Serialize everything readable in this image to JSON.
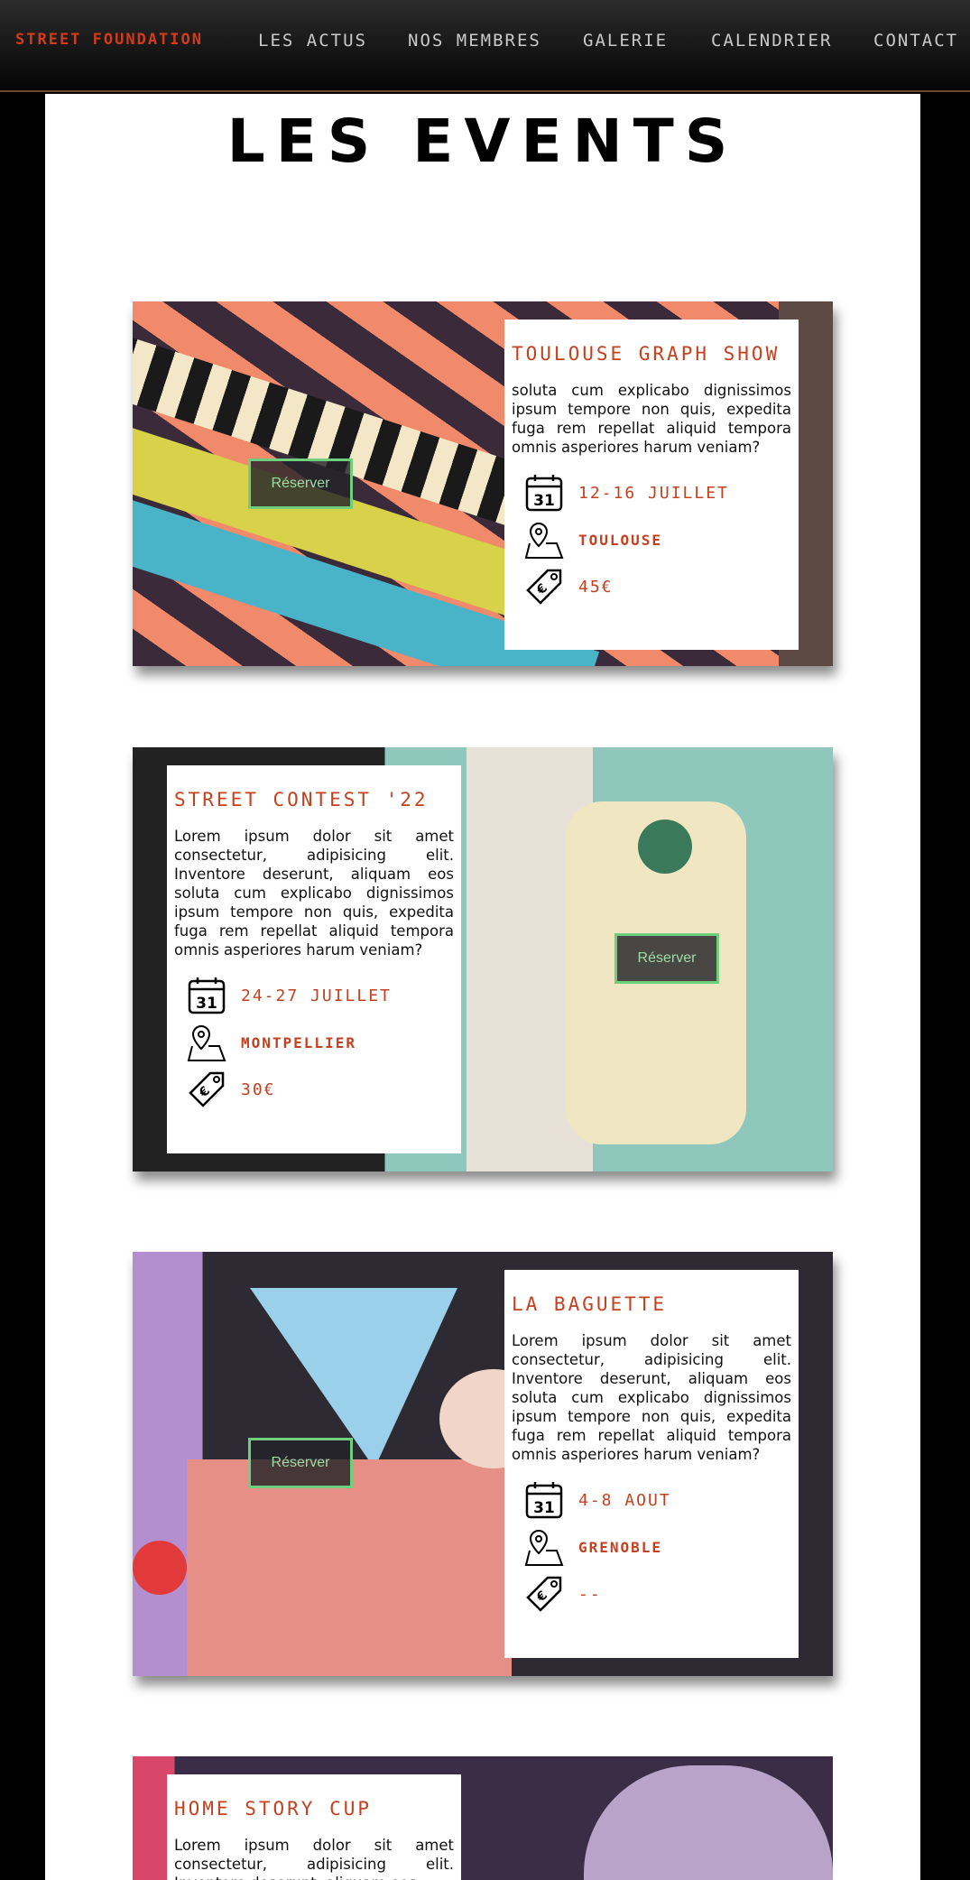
{
  "nav": {
    "brand": "STREET FOUNDATION",
    "links": [
      "LES ACTUS",
      "NOS MEMBRES",
      "GALERIE",
      "CALENDRIER",
      "CONTACT"
    ]
  },
  "page_title": "LES EVENTS",
  "events": [
    {
      "title": "TOULOUSE GRAPH SHOW",
      "description": "soluta cum explicabo dignissimos ipsum tempore non quis, expedita fuga rem repellat aliquid tempora omnis asperiores harum veniam?",
      "date": "12-16 JUILLET",
      "location": "TOULOUSE",
      "price": "45€",
      "button": "Réserver"
    },
    {
      "title": "STREET CONTEST '22",
      "description": "Lorem ipsum dolor sit amet consectetur, adipisicing elit. Inventore deserunt, aliquam eos soluta cum explicabo dignissimos ipsum tempore non quis, expedita fuga rem repellat aliquid tempora omnis asperiores harum veniam?",
      "date": "24-27 JUILLET",
      "location": "MONTPELLIER",
      "price": "30€",
      "button": "Réserver"
    },
    {
      "title": "LA BAGUETTE",
      "description": "Lorem ipsum dolor sit amet consectetur, adipisicing elit. Inventore deserunt, aliquam eos soluta cum explicabo dignissimos ipsum tempore non quis, expedita fuga rem repellat aliquid tempora omnis asperiores harum veniam?",
      "date": "4-8 AOUT",
      "location": "GRENOBLE",
      "price": "--",
      "button": "Réserver"
    },
    {
      "title": "HOME STORY CUP",
      "description": "Lorem ipsum dolor sit amet consectetur, adipisicing elit. Inventore deserunt, aliquam eos"
    }
  ],
  "colors": {
    "accent": "#c4411f",
    "button_border": "#6fcf7c"
  },
  "icons": {
    "date": "calendar-icon",
    "location": "map-pin-icon",
    "price": "price-tag-icon"
  }
}
